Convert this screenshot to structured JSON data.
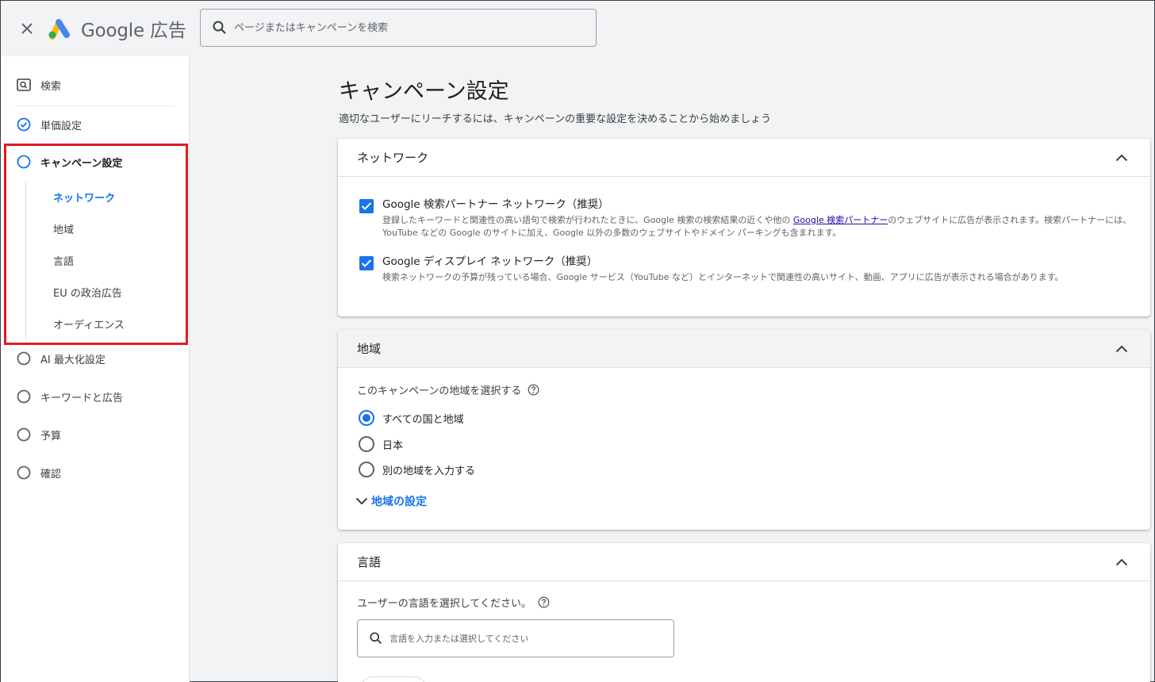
{
  "app": {
    "logo_text": "Google 広告"
  },
  "search": {
    "placeholder": "ページまたはキャンペーンを検索"
  },
  "sidebar": {
    "items": [
      {
        "label": "検索",
        "icon": "search-box-icon"
      },
      {
        "label": "単価設定",
        "icon": "check-circle-icon",
        "state": "completed"
      },
      {
        "label": "キャンペーン設定",
        "icon": "circle-icon",
        "state": "current"
      },
      {
        "label": "AI 最大化設定",
        "icon": "circle-icon"
      },
      {
        "label": "キーワードと広告",
        "icon": "circle-icon"
      },
      {
        "label": "予算",
        "icon": "circle-icon"
      },
      {
        "label": "確認",
        "icon": "circle-icon"
      }
    ],
    "sub_items": [
      {
        "label": "ネットワーク",
        "active": true
      },
      {
        "label": "地域"
      },
      {
        "label": "言語"
      },
      {
        "label": "EU の政治広告"
      },
      {
        "label": "オーディエンス"
      }
    ]
  },
  "main": {
    "title": "キャンペーン設定",
    "subtitle": "適切なユーザーにリーチするには、キャンペーンの重要な設定を決めることから始めましょう",
    "network": {
      "header": "ネットワーク",
      "search_partners": {
        "title": "Google 検索パートナー ネットワーク（推奨）",
        "desc_before": "登録したキーワードと関連性の高い語句で検索が行われたときに、Google 検索の検索結果の近くや他の ",
        "link": "Google 検索パートナー",
        "desc_after": "のウェブサイトに広告が表示されます。検索パートナーには、YouTube などの Google のサイトに加え、Google 以外の多数のウェブサイトやドメイン パーキングも含まれます。",
        "checked": true
      },
      "display": {
        "title": "Google ディスプレイ ネットワーク（推奨）",
        "desc": "検索ネットワークの予算が残っている場合、Google サービス（YouTube など）とインターネットで関連性の高いサイト、動画、アプリに広告が表示される場合があります。",
        "checked": true
      }
    },
    "locations": {
      "header": "地域",
      "label": "このキャンペーンの地域を選択する",
      "options": [
        "すべての国と地域",
        "日本",
        "別の地域を入力する"
      ],
      "selected": "すべての国と地域",
      "expand_label": "地域の設定"
    },
    "languages": {
      "header": "言語",
      "label": "ユーザーの言語を選択してください。",
      "placeholder": "言語を入力または選択してください"
    }
  },
  "colors": {
    "accent": "#1a73e8",
    "highlight": "#e01b24",
    "background": "#f1f3f4"
  }
}
